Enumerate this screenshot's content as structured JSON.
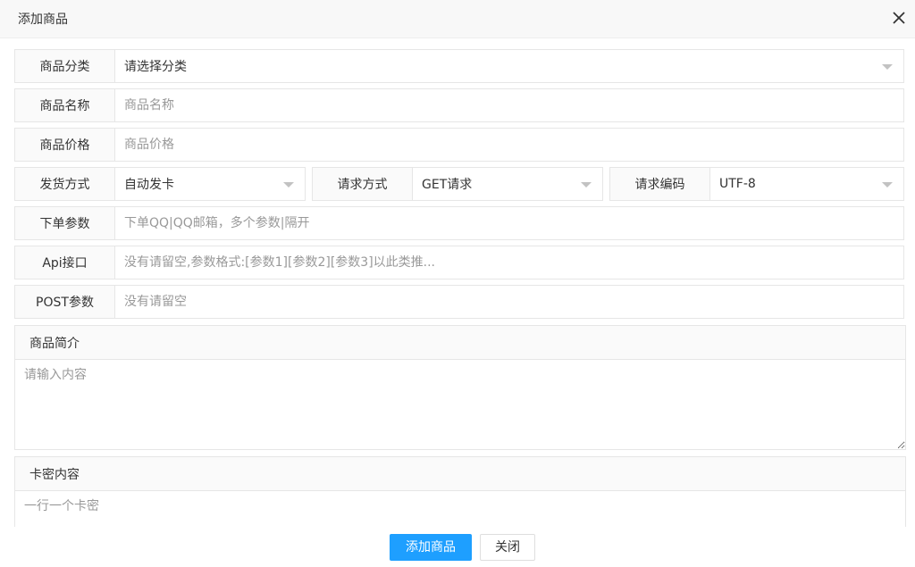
{
  "dialog": {
    "title": "添加商品"
  },
  "form": {
    "category": {
      "label": "商品分类",
      "value": "请选择分类"
    },
    "name": {
      "label": "商品名称",
      "placeholder": "商品名称"
    },
    "price": {
      "label": "商品价格",
      "placeholder": "商品价格"
    },
    "delivery": {
      "label": "发货方式",
      "value": "自动发卡"
    },
    "request_method": {
      "label": "请求方式",
      "value": "GET请求"
    },
    "request_encoding": {
      "label": "请求编码",
      "value": "UTF-8"
    },
    "order_params": {
      "label": "下单参数",
      "placeholder": "下单QQ|QQ邮箱，多个参数|隔开"
    },
    "api": {
      "label": "Api接口",
      "placeholder": "没有请留空,参数格式:[参数1][参数2][参数3]以此类推..."
    },
    "post_params": {
      "label": "POST参数",
      "placeholder": "没有请留空"
    },
    "intro": {
      "label": "商品简介",
      "placeholder": "请输入内容"
    },
    "cards": {
      "label": "卡密内容",
      "placeholder": "一行一个卡密"
    }
  },
  "buttons": {
    "submit": "添加商品",
    "close": "关闭"
  },
  "colors": {
    "primary": "#1e9fff",
    "label_bg": "#fafafa",
    "border": "#e6e6e6"
  }
}
